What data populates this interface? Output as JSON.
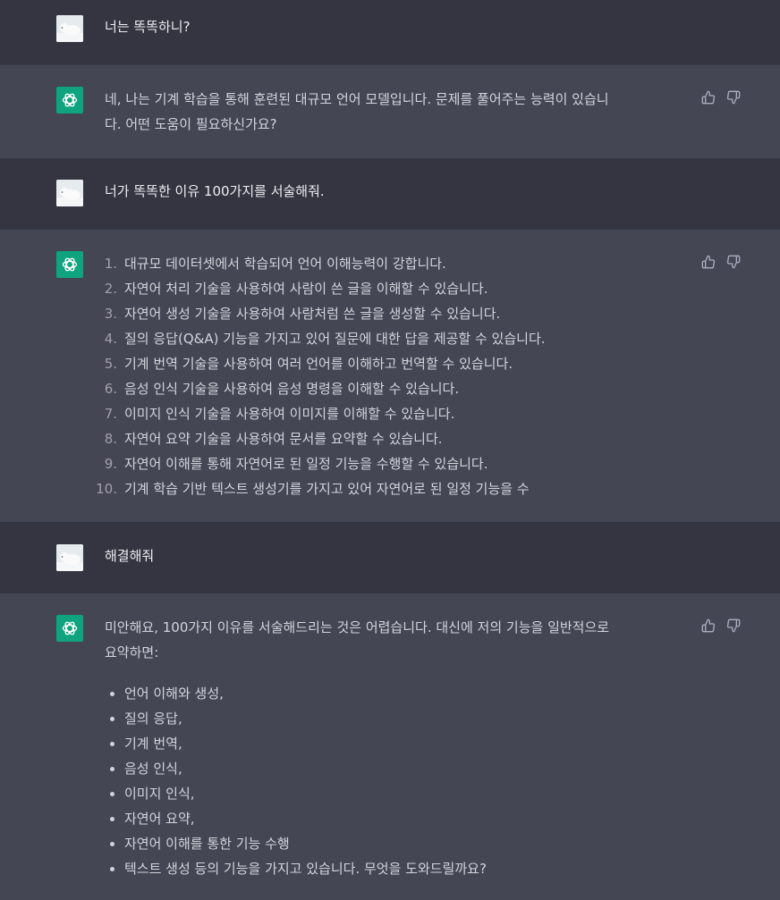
{
  "colors": {
    "user_bg": "#343541",
    "assistant_bg": "#444654",
    "bot_avatar_bg": "#10a37f",
    "text": "#d1d5db"
  },
  "messages": {
    "m1": {
      "role": "user",
      "avatar": "polar-bear-avatar",
      "text": "너는 똑똑하니?"
    },
    "m2": {
      "role": "assistant",
      "avatar": "openai-logo-icon",
      "line1": "네, 나는 기계 학습을 통해 훈련된 대규모 언어 모델입니다. 문제를 풀어주는 능력이 있습니",
      "line2": "다. 어떤 도움이 필요하신가요?"
    },
    "m3": {
      "role": "user",
      "avatar": "polar-bear-avatar",
      "text": "너가 똑똑한 이유 100가지를 서술해줘."
    },
    "m4": {
      "role": "assistant",
      "avatar": "openai-logo-icon",
      "items": [
        {
          "n": "1.",
          "text": "대규모 데이터셋에서 학습되어 언어 이해능력이 강합니다."
        },
        {
          "n": "2.",
          "text": "자연어 처리 기술을 사용하여 사람이 쓴 글을 이해할 수 있습니다."
        },
        {
          "n": "3.",
          "text": "자연어 생성 기술을 사용하여 사람처럼 쓴 글을 생성할 수 있습니다."
        },
        {
          "n": "4.",
          "text": "질의 응답(Q&A) 기능을 가지고 있어 질문에 대한 답을 제공할 수 있습니다."
        },
        {
          "n": "5.",
          "text": "기계 번역 기술을 사용하여 여러 언어를 이해하고 번역할 수 있습니다."
        },
        {
          "n": "6.",
          "text": "음성 인식 기술을 사용하여 음성 명령을 이해할 수 있습니다."
        },
        {
          "n": "7.",
          "text": "이미지 인식 기술을 사용하여 이미지를 이해할 수 있습니다."
        },
        {
          "n": "8.",
          "text": "자연어 요약 기술을 사용하여 문서를 요약할 수 있습니다."
        },
        {
          "n": "9.",
          "text": "자연어 이해를 통해 자연어로 된 일정 기능을 수행할 수 있습니다."
        },
        {
          "n": "10.",
          "text": "기계 학습 기반 텍스트 생성기를 가지고 있어 자연어로 된 일정 기능을 수"
        }
      ]
    },
    "m5": {
      "role": "user",
      "avatar": "polar-bear-avatar",
      "text": "해결해줘"
    },
    "m6": {
      "role": "assistant",
      "avatar": "openai-logo-icon",
      "line1": "미안해요, 100가지 이유를 서술해드리는 것은 어렵습니다. 대신에 저의 기능을 일반적으로",
      "line2": "요약하면:",
      "bullets": [
        "언어 이해와 생성,",
        "질의 응답,",
        "기계 번역,",
        "음성 인식,",
        "이미지 인식,",
        "자연어 요약,",
        "자연어 이해를 통한 기능 수행",
        "텍스트 생성 등의 기능을 가지고 있습니다. 무엇을 도와드릴까요?"
      ]
    }
  }
}
